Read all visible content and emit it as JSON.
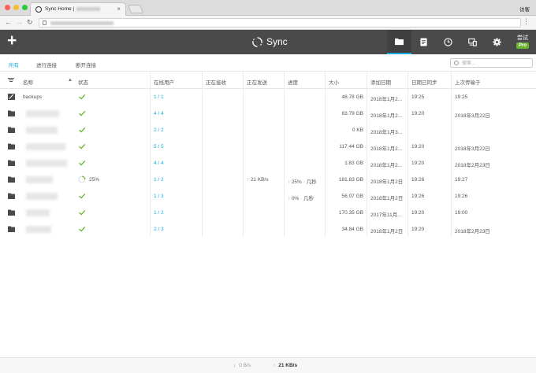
{
  "browser": {
    "tab_title": "Sync Home |",
    "tab_close": "×",
    "guest_label": "访客",
    "nav_back": "←",
    "nav_forward": "→",
    "nav_reload": "C",
    "menu": "⋮"
  },
  "app": {
    "add_label": "+",
    "logo_text": "Sync",
    "try_label": "尝试",
    "pro_badge": "Pro",
    "active_nav": "folders-icon"
  },
  "filters": {
    "all": "所有",
    "connected": "进行连接",
    "disconnected": "断开连接",
    "search_placeholder": "搜索..."
  },
  "columns": {
    "name": "名称",
    "sort": "▲",
    "status": "状态",
    "online_peers": "在线用户",
    "receiving": "正在接收",
    "sending": "正在发送",
    "progress": "进度",
    "size": "大小",
    "date_added": "添加日期",
    "synced_date": "日期已同步",
    "last_transfer": "上次传输于"
  },
  "rows": [
    {
      "name": "backups",
      "name_blur_w": 0,
      "status": "done",
      "peers": "1 / 1",
      "sending": "",
      "progress": "",
      "size": "48.78 GB",
      "added": "2018年1月2...",
      "synced": "19:25",
      "last": "19:25"
    },
    {
      "name": "",
      "name_blur_w": 42,
      "status": "done",
      "peers": "4 / 4",
      "sending": "",
      "progress": "",
      "size": "83.79 GB",
      "added": "2018年1月2...",
      "synced": "19:20",
      "last": "2018年3月22日"
    },
    {
      "name": "",
      "name_blur_w": 40,
      "status": "done",
      "peers": "2 / 2",
      "sending": "",
      "progress": "",
      "size": "0 KB",
      "added": "2018年1月3...",
      "synced": "",
      "last": ""
    },
    {
      "name": "",
      "name_blur_w": 50,
      "status": "done",
      "peers": "5 / 5",
      "sending": "",
      "progress": "",
      "size": "117.44 GB",
      "added": "2018年1月2...",
      "synced": "19:20",
      "last": "2018年3月22日"
    },
    {
      "name": "",
      "name_blur_w": 52,
      "status": "done",
      "peers": "4 / 4",
      "sending": "",
      "progress": "",
      "size": "1.83 GB",
      "added": "2018年1月2...",
      "synced": "19:20",
      "last": "2018年2月23日"
    },
    {
      "name": "",
      "name_blur_w": 34,
      "status": "syncing",
      "status_text": "25%",
      "peers": "1 / 2",
      "sending": "21 KB/s",
      "progress": "25%",
      "progress_eta": "几秒",
      "size": "181.83 GB",
      "added": "2018年1月2日",
      "synced": "19:26",
      "last": "19:27"
    },
    {
      "name": "",
      "name_blur_w": 40,
      "status": "done",
      "peers": "1 / 3",
      "sending": "",
      "progress": "0%",
      "progress_eta": "几秒",
      "size": "56.07 GB",
      "added": "2018年1月2日",
      "synced": "19:26",
      "last": "19:26"
    },
    {
      "name": "",
      "name_blur_w": 30,
      "status": "done",
      "peers": "1 / 2",
      "sending": "",
      "progress": "",
      "size": "170.35 GB",
      "added": "2017年11月...",
      "synced": "19:20",
      "last": "19:00"
    },
    {
      "name": "",
      "name_blur_w": 32,
      "status": "done",
      "peers": "2 / 3",
      "sending": "",
      "progress": "",
      "size": "34.84 GB",
      "added": "2018年1月2日",
      "synced": "19:20",
      "last": "2018年2月23日"
    }
  ],
  "footer": {
    "down_arrow": "↓",
    "down_speed": "0 B/s",
    "up_arrow": "↑",
    "up_speed": "21 KB/s"
  },
  "colors": {
    "accent": "#1aa9e1",
    "success": "#69b52e",
    "header_bg": "#4a4a4a"
  }
}
